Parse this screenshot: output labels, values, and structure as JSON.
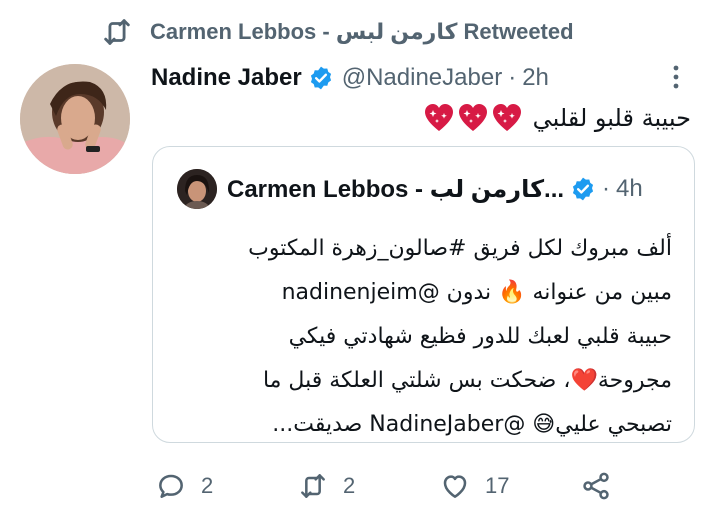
{
  "retweet": {
    "label": "Carmen Lebbos - كارمن لبس Retweeted"
  },
  "tweet": {
    "author": "Nadine Jaber",
    "handle": "@NadineJaber",
    "separator": "·",
    "time": "2h",
    "text": "حبيبة قلبو لقلبي"
  },
  "quote": {
    "author": "Carmen Lebbos - كارمن لب...",
    "separator": "·",
    "time": "4h",
    "lines": [
      "ألف مبروك لكل فريق #صالون_زهرة المكتوب",
      "مبين من عنوانه 🔥 ندون @nadinenjeim",
      "حبيبة قلبي لعبك للدور فظيع شهادتي فيكي",
      "مجروحة❤️، ضحكت بس شلتي العلكة قبل ما",
      "تصبحي عليي😅 @NadineJaber صديقت..."
    ]
  },
  "actions": {
    "replies": "2",
    "retweets": "2",
    "likes": "17"
  },
  "colors": {
    "text": "#0f1419",
    "muted": "#536471",
    "verified": "#1d9bf0",
    "heart": "#d71a45",
    "border": "#cfd9de"
  },
  "icons": [
    "retweet-icon",
    "verified-badge-icon",
    "more-icon",
    "sparkling-heart-icon",
    "reply-icon",
    "like-icon",
    "share-icon"
  ]
}
